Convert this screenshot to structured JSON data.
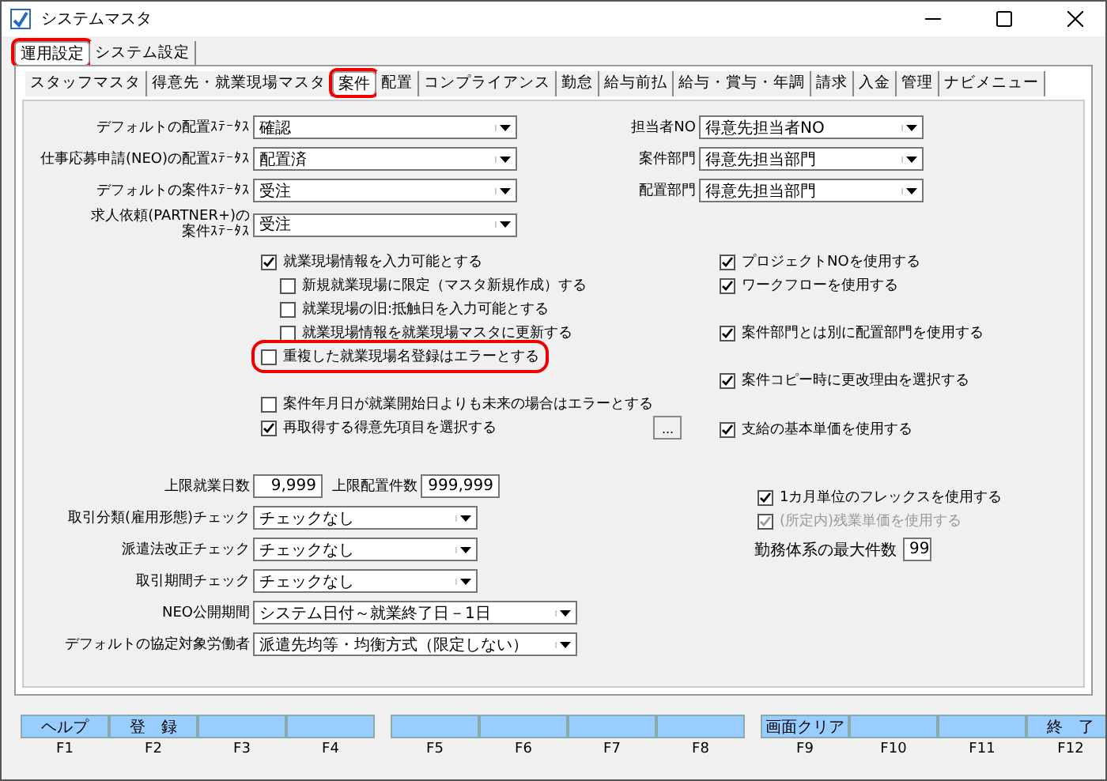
{
  "window": {
    "title": "システムマスタ"
  },
  "outer_tabs": [
    {
      "label": "運用設定",
      "selected": true,
      "highlighted": true
    },
    {
      "label": "システム設定",
      "selected": false,
      "highlighted": false
    }
  ],
  "inner_tabs": [
    {
      "label": "スタッフマスタ",
      "selected": false,
      "highlighted": false
    },
    {
      "label": "得意先・就業現場マスタ",
      "selected": false,
      "highlighted": false
    },
    {
      "label": "案件",
      "selected": true,
      "highlighted": true
    },
    {
      "label": "配置",
      "selected": false,
      "highlighted": false
    },
    {
      "label": "コンプライアンス",
      "selected": false,
      "highlighted": false
    },
    {
      "label": "勤怠",
      "selected": false,
      "highlighted": false
    },
    {
      "label": "給与前払",
      "selected": false,
      "highlighted": false
    },
    {
      "label": "給与・賞与・年調",
      "selected": false,
      "highlighted": false
    },
    {
      "label": "請求",
      "selected": false,
      "highlighted": false
    },
    {
      "label": "入金",
      "selected": false,
      "highlighted": false
    },
    {
      "label": "管理",
      "selected": false,
      "highlighted": false
    },
    {
      "label": "ナビメニュー",
      "selected": false,
      "highlighted": false
    }
  ],
  "left_selects": [
    {
      "label": "デフォルトの配置ｽﾃｰﾀｽ",
      "value": "確認"
    },
    {
      "label": "仕事応募申請(NEO)の配置ｽﾃｰﾀｽ",
      "value": "配置済"
    },
    {
      "label": "デフォルトの案件ｽﾃｰﾀｽ",
      "value": "受注"
    },
    {
      "label": "求人依頼(PARTNER+)の",
      "label_2": "案件ｽﾃｰﾀｽ",
      "value": "受注"
    }
  ],
  "right_selects": [
    {
      "label": "担当者NO",
      "value": "得意先担当者NO"
    },
    {
      "label": "案件部門",
      "value": "得意先担当部門"
    },
    {
      "label": "配置部門",
      "value": "得意先担当部門"
    }
  ],
  "left_checks": [
    {
      "label": "就業現場情報を入力可能とする",
      "checked": true,
      "highlighted": false,
      "children": [
        {
          "label": "新規就業現場に限定（マスタ新規作成）する",
          "checked": false,
          "highlighted": false
        },
        {
          "label": "就業現場の旧:抵触日を入力可能とする",
          "checked": false,
          "highlighted": false
        },
        {
          "label": "就業現場情報を就業現場マスタに更新する",
          "checked": false,
          "highlighted": false
        }
      ]
    },
    {
      "label": "重複した就業現場名登録はエラーとする",
      "checked": false,
      "highlighted": true
    },
    {
      "label": "案件年月日が就業開始日よりも未来の場合はエラーとする",
      "checked": false,
      "highlighted": false
    },
    {
      "label": "再取得する得意先項目を選択する",
      "checked": true,
      "highlighted": false,
      "button": "..."
    }
  ],
  "right_checks": [
    {
      "label": "プロジェクトNOを使用する",
      "checked": true
    },
    {
      "label": "ワークフローを使用する",
      "checked": true
    },
    {
      "label": "案件部門とは別に配置部門を使用する",
      "checked": true
    },
    {
      "label": "案件コピー時に更改理由を選択する",
      "checked": true
    },
    {
      "label": "支給の基本単価を使用する",
      "checked": true
    }
  ],
  "limits": [
    {
      "label": "上限就業日数",
      "value": "9,999"
    },
    {
      "label": "上限配置件数",
      "value": "999,999"
    }
  ],
  "bottom_selects": [
    {
      "label": "取引分類(雇用形態)チェック",
      "value": "チェックなし",
      "wide": false
    },
    {
      "label": "派遣法改正チェック",
      "value": "チェックなし",
      "wide": false
    },
    {
      "label": "取引期間チェック",
      "value": "チェックなし",
      "wide": false
    },
    {
      "label": "NEO公開期間",
      "value": "システム日付～就業終了日－1日",
      "wide": true
    },
    {
      "label": "デフォルトの協定対象労働者",
      "value": "派遣先均等・均衡方式（限定しない）",
      "wide": true
    }
  ],
  "bottom_right_checks": [
    {
      "label": "1カ月単位のフレックスを使用する",
      "checked": true,
      "disabled": false
    },
    {
      "label": "(所定内)残業単価を使用する",
      "checked": true,
      "disabled": true
    }
  ],
  "max_count": {
    "label": "勤務体系の最大件数",
    "value": "99"
  },
  "function_keys": [
    {
      "key": "F1",
      "label": "ヘルプ"
    },
    {
      "key": "F2",
      "label": "登　録"
    },
    {
      "key": "F3"
    },
    {
      "key": "F4"
    },
    {
      "key": "F5"
    },
    {
      "key": "F6"
    },
    {
      "key": "F7"
    },
    {
      "key": "F8"
    },
    {
      "key": "F9",
      "label": "画面クリア"
    },
    {
      "key": "F10"
    },
    {
      "key": "F11"
    },
    {
      "key": "F12",
      "label": "終　了"
    }
  ]
}
